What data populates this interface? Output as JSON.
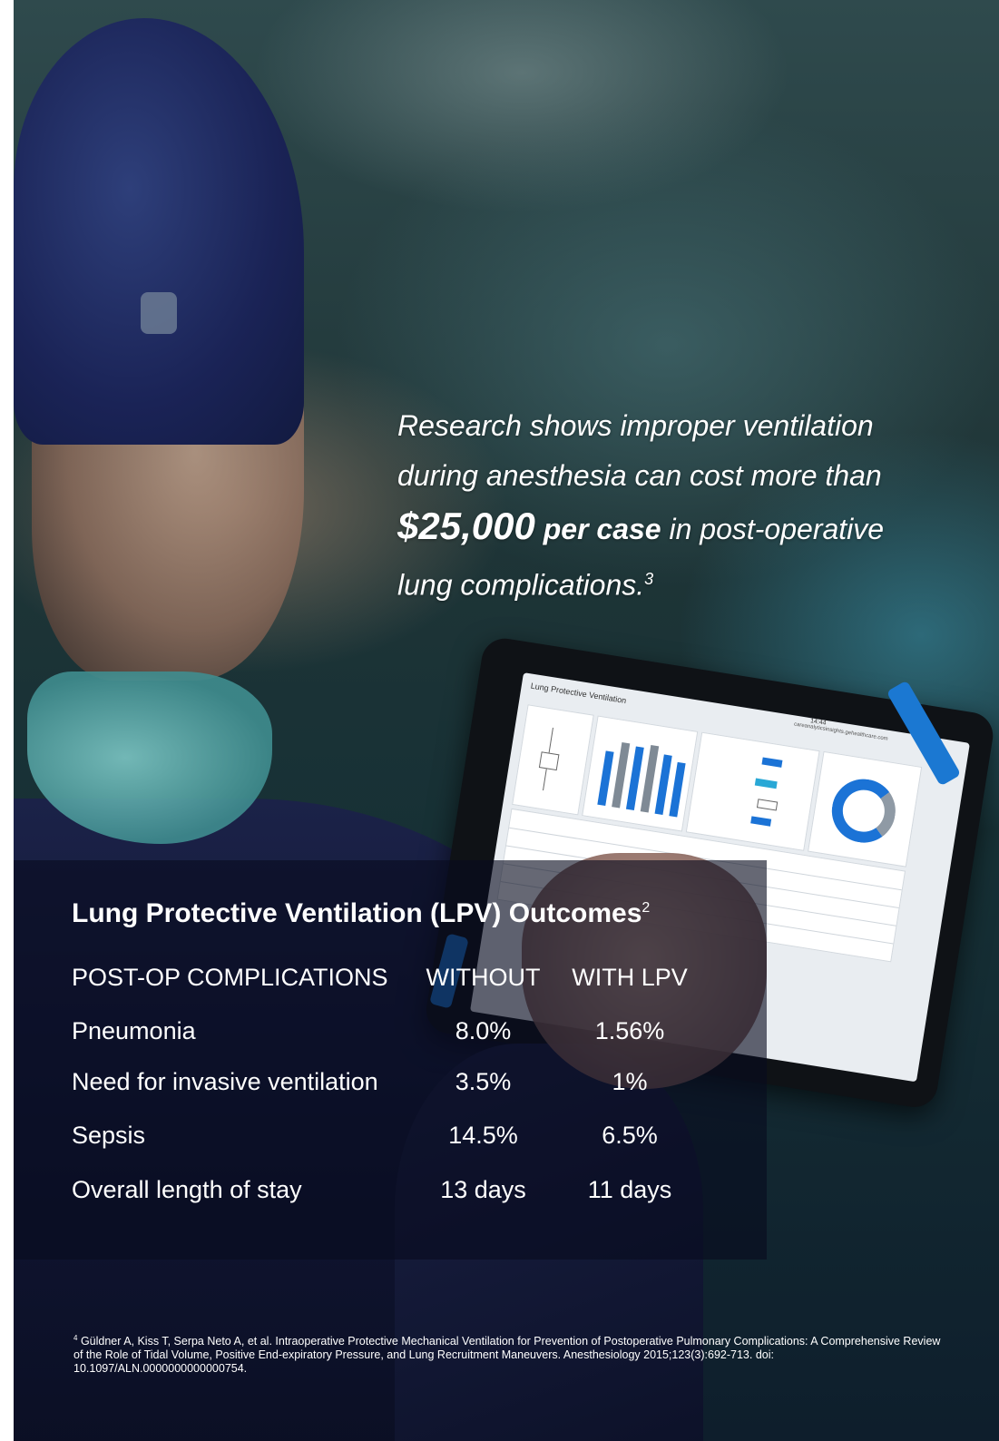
{
  "headline": {
    "line1": "Research shows improper ventilation",
    "line2": "during anesthesia can cost more than",
    "amount": "$25,000",
    "per_case": "per case",
    "line3_rest": "in post-operative",
    "line4": "lung complications.",
    "ref": "3"
  },
  "tablet_screen": {
    "title": "Lung Protective Ventilation",
    "time": "14:44",
    "url": "careanalyticsinsights.gehealthcare.com"
  },
  "outcomes": {
    "title": "Lung Protective Ventilation (LPV) Outcomes",
    "title_ref": "2",
    "headers": {
      "complication": "POST-OP COMPLICATIONS",
      "without": "WITHOUT",
      "with": "WITH LPV"
    },
    "rows": [
      {
        "label": "Pneumonia",
        "without": "8.0%",
        "with": "1.56%"
      },
      {
        "label": "Need for invasive ventilation",
        "without": "3.5%",
        "with": "1%"
      },
      {
        "label": "Sepsis",
        "without": "14.5%",
        "with": "6.5%"
      },
      {
        "label": "Overall length of stay",
        "without": "13 days",
        "with": "11 days"
      }
    ]
  },
  "footnote": {
    "marker": "4",
    "text": "Güldner A, Kiss T, Serpa Neto A, et al. Intraoperative Protective Mechanical Ventilation for Prevention of Postoperative Pulmonary Complications: A Comprehensive Review of the Role of Tidal Volume, Positive End-expiratory Pressure, and Lung Recruitment Maneuvers. Anesthesiology 2015;123(3):692-713. doi: 10.1097/ALN.0000000000000754."
  }
}
